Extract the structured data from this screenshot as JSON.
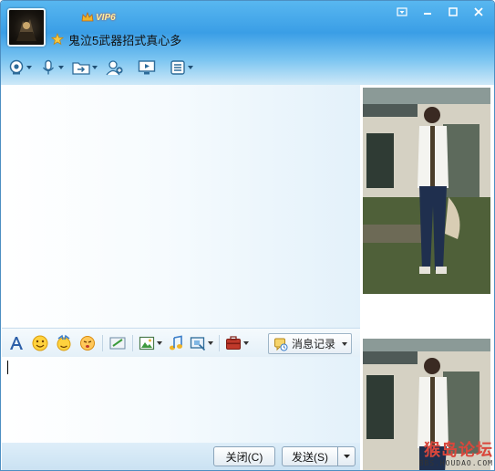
{
  "contact": {
    "name": "鬼泣5武器招式真心多",
    "vip_label": "VIP6"
  },
  "toolbar_top": {
    "items": [
      "webcam-icon",
      "microphone-icon",
      "file-transfer-icon",
      "add-contact-icon",
      "screen-share-icon",
      "apps-menu-icon"
    ]
  },
  "format_toolbar": {
    "history_label": "消息记录"
  },
  "buttons": {
    "close_label": "关闭(C)",
    "send_label": "发送(S)"
  },
  "watermark": {
    "main": "猴岛论坛",
    "sub": "BBS.HOUDAO.COM"
  },
  "colors": {
    "header_top": "#3a9ee6",
    "accent": "#4d8fc2",
    "watermark": "#d9473c"
  }
}
